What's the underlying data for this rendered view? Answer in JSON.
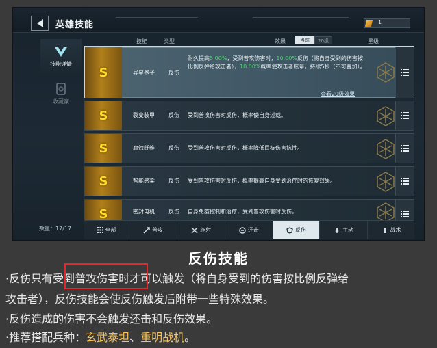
{
  "header": {
    "title": "英雄技能",
    "resource_value": "1"
  },
  "sidebar": {
    "items": [
      {
        "label": "技能详情",
        "active": true
      },
      {
        "label": "收藏家",
        "active": false
      }
    ],
    "count": "数量：17/17"
  },
  "table": {
    "headers": {
      "skill": "技能",
      "type": "类型",
      "effect": "效果",
      "star": "星级"
    },
    "effect_toggle": {
      "current": "当前",
      "level20": "20级"
    }
  },
  "skills": [
    {
      "rank": "S",
      "name": "异星孢子",
      "type": "反伤",
      "effect": {
        "t1": "耐久提高",
        "v1": "5.00%",
        "t2": "，受到普攻伤害时，",
        "v2": "10.00%",
        "t3": "反伤（将自身受到的伤害按比例反弹给攻击者），",
        "v3": "10.00%",
        "t4": "概率使攻击者眩晕，持续5秒（不可叠加）。"
      },
      "link": "查看20级效果"
    },
    {
      "rank": "S",
      "name": "裂变装甲",
      "type": "反伤",
      "effect": "受到普攻伤害时反伤，概率使自身过载。"
    },
    {
      "rank": "S",
      "name": "腐蚀纤维",
      "type": "反伤",
      "effect": "受到普攻伤害时反伤，概率降低目标伤害抗性。"
    },
    {
      "rank": "S",
      "name": "智能感染",
      "type": "反伤",
      "effect": "受到普攻伤害时反伤，概率提高自身受到治疗时的恢复效果。"
    },
    {
      "rank": "S",
      "name": "密封电机",
      "type": "反伤",
      "effect": "自身免疫控制和治疗，受到普攻伤害时反伤。"
    }
  ],
  "tabs": [
    {
      "label": "全部",
      "icon": "grid-icon"
    },
    {
      "label": "普攻",
      "icon": "sword-icon"
    },
    {
      "label": "施射",
      "icon": "arrows-icon"
    },
    {
      "label": "还击",
      "icon": "counter-icon"
    },
    {
      "label": "反伤",
      "icon": "shield-reflect-icon",
      "active": true
    },
    {
      "label": "主动",
      "icon": "flame-icon"
    },
    {
      "label": "战术",
      "icon": "chess-icon"
    }
  ],
  "section": {
    "title": "反伤技能",
    "p1_a": "·反伤只有",
    "p1_b": "受到普攻伤害",
    "p1_c": "时才可以触发（将自身受到的伤害按比例反弹给",
    "p1_d": "攻击者），反伤技能会使反伤触发后附带一些特殊效果。",
    "p2": "·反伤造成的伤害不会触发还击和反伤效果。",
    "p3_a": "·推荐搭配兵种：",
    "p3_b": "玄武泰坦",
    "p3_c": "、",
    "p3_d": "重明战机",
    "p3_e": "。"
  },
  "colors": {
    "accent_gold": "#ffdb2e",
    "highlight_green": "#4fd26a",
    "highlight_yellow": "#f7c25b",
    "annotation_red": "#e8262a"
  }
}
